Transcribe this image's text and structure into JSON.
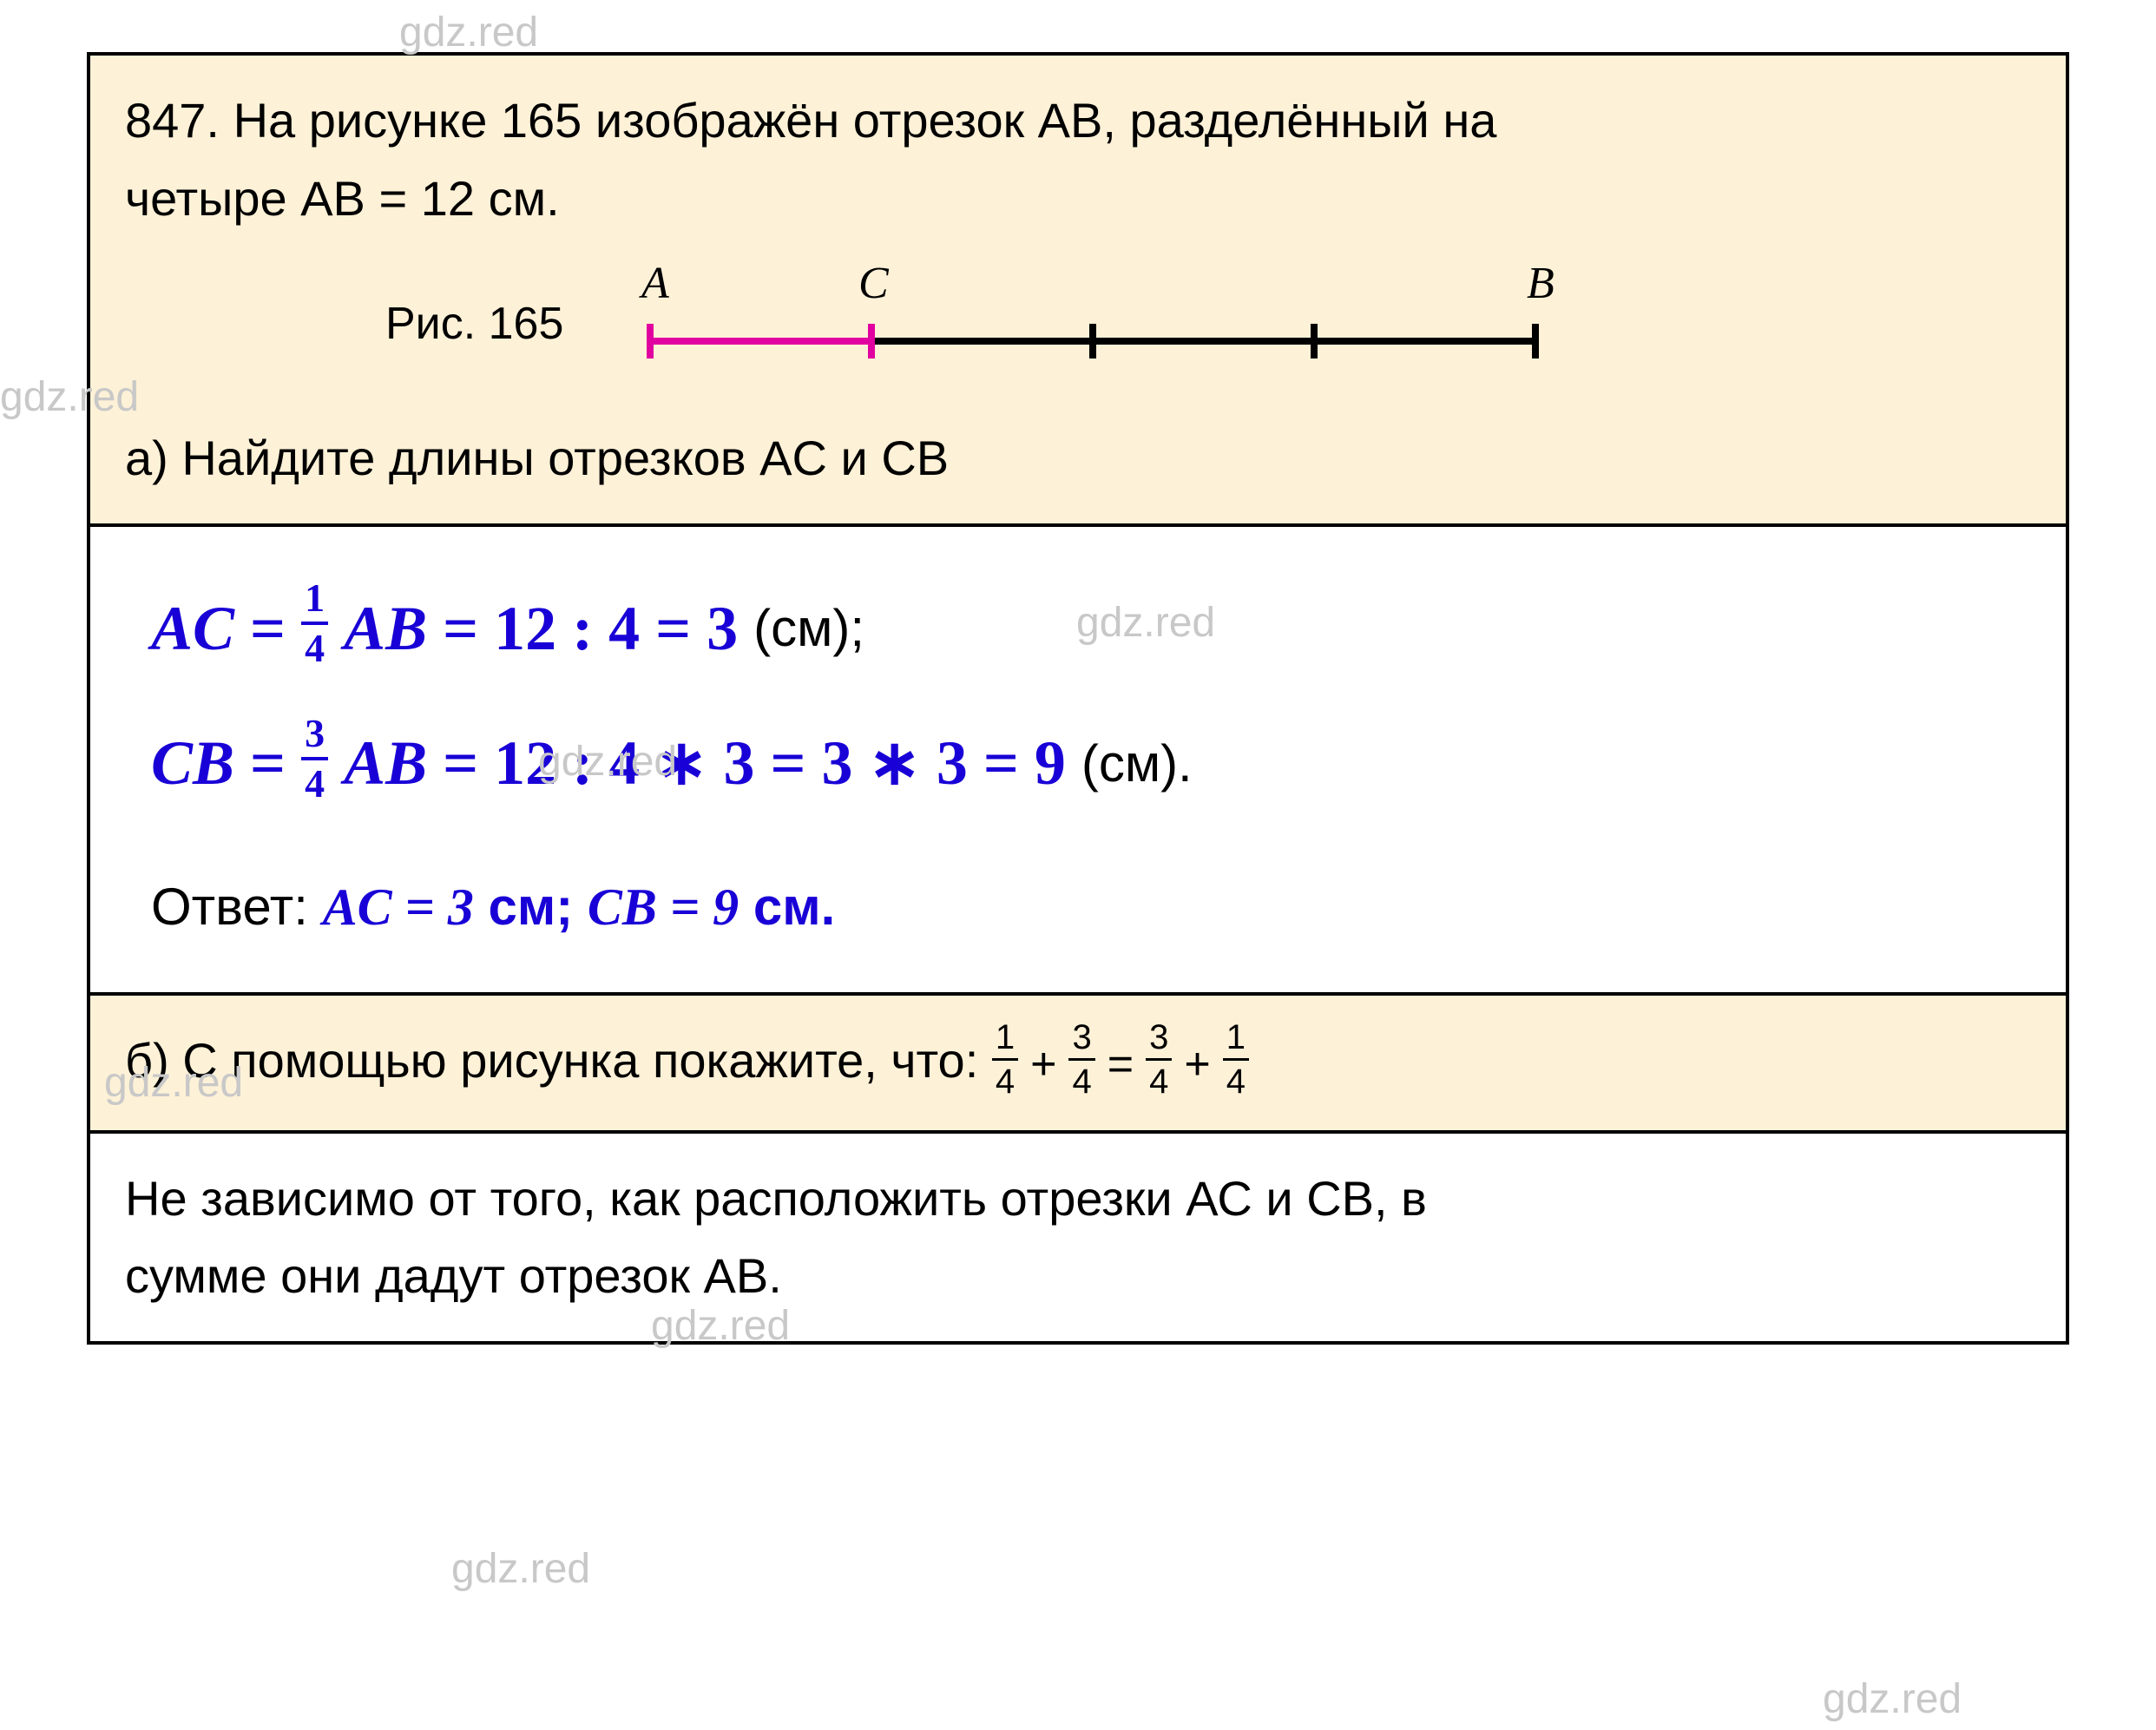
{
  "watermark": "gdz.red",
  "problem": {
    "number": "847.",
    "text_line1": "На рисунке 165 изображён отрезок АВ, разделённый на",
    "text_line2": "четыре АВ = 12 см.",
    "figure_label": "Рис. 165",
    "points": {
      "A": "A",
      "C": "C",
      "B": "B"
    },
    "part_a": "a) Найдите длины отрезков AC и CB"
  },
  "solution_a": {
    "line1": {
      "lhs": "AC",
      "eq": "=",
      "frac_num": "1",
      "frac_den": "4",
      "mid": "AB",
      "calc": "= 12 : 4 = 3",
      "unit": "(см);"
    },
    "line2": {
      "lhs": "CB",
      "eq": "=",
      "frac_num": "3",
      "frac_den": "4",
      "mid": "AB",
      "calc": "= 12 : 4 ∗ 3 = 3 ∗ 3 = 9",
      "unit": "(см)."
    },
    "answer_label": "Ответ:",
    "answer_ac_var": "AC",
    "answer_ac_eq": " = ",
    "answer_ac_val": "3",
    "answer_ac_unit": " см",
    "answer_sep": "; ",
    "answer_cb_var": "CB",
    "answer_cb_eq": " = ",
    "answer_cb_val": "9",
    "answer_cb_unit": " см."
  },
  "part_b": {
    "prefix": "б) С помощью рисунка покажите, что: ",
    "f1n": "1",
    "f1d": "4",
    "plus1": "+",
    "f2n": "3",
    "f2d": "4",
    "eq": "=",
    "f3n": "3",
    "f3d": "4",
    "plus2": "+",
    "f4n": "1",
    "f4d": "4"
  },
  "solution_b": {
    "line1": "Не зависимо от того, как расположить отрезки АС и СВ, в",
    "line2": "сумме они дадут отрезок АВ."
  }
}
